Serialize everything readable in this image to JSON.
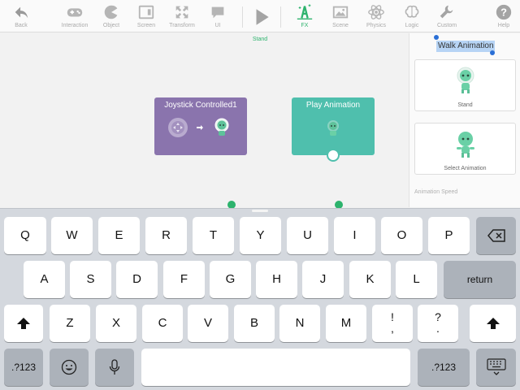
{
  "toolbar": {
    "back": "Back",
    "interaction": "Interaction",
    "object": "Object",
    "screen": "Screen",
    "transform": "Transform",
    "ui": "UI",
    "fx": "FX",
    "scene": "Scene",
    "physics": "Physics",
    "logic": "Logic",
    "custom": "Custom",
    "help": "Help",
    "accent_color": "#2db36d"
  },
  "canvas": {
    "scene_label": "Stand",
    "nodes": {
      "joystick_title": "Joystick Controlled1",
      "play_title": "Play Animation"
    }
  },
  "panel": {
    "animation_name": "Walk Animation",
    "cards": [
      {
        "label": "Stand"
      },
      {
        "label": "Select Animation"
      }
    ],
    "speed_label": "Animation Speed"
  },
  "keyboard": {
    "row1": [
      "Q",
      "W",
      "E",
      "R",
      "T",
      "Y",
      "U",
      "I",
      "O",
      "P"
    ],
    "row2": [
      "A",
      "S",
      "D",
      "F",
      "G",
      "H",
      "J",
      "K",
      "L"
    ],
    "row3": [
      "Z",
      "X",
      "C",
      "V",
      "B",
      "N",
      "M"
    ],
    "punct1_top": "!",
    "punct1_bottom": ",",
    "punct2_top": "?",
    "punct2_bottom": ".",
    "return_label": "return",
    "numbers_label": ".?123"
  }
}
